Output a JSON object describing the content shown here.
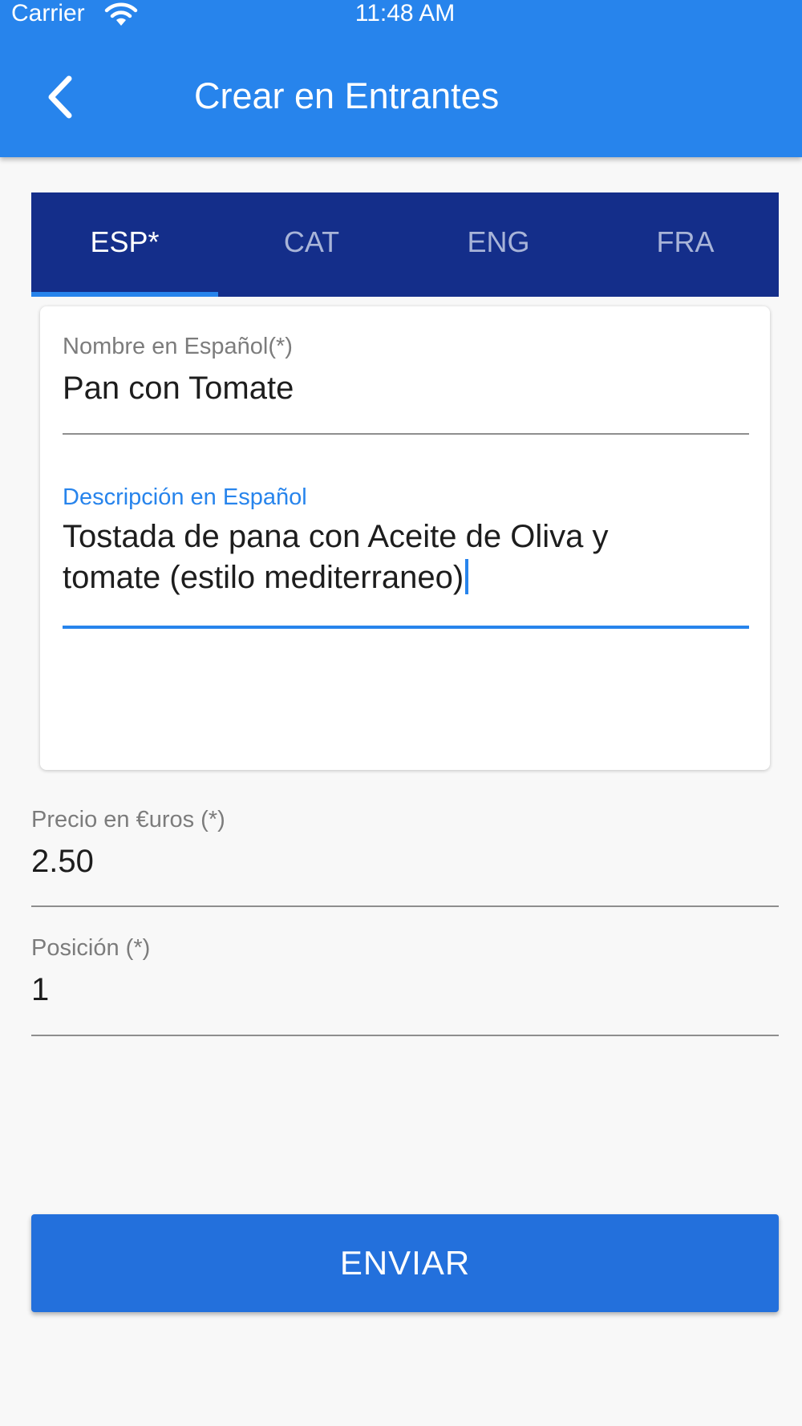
{
  "status_bar": {
    "carrier": "Carrier",
    "time": "11:48 AM"
  },
  "header": {
    "title": "Crear en Entrantes",
    "back_icon": "chevron-left-icon",
    "background_color": "#2784ec"
  },
  "tabs": {
    "items": [
      {
        "label": "ESP*",
        "active": true
      },
      {
        "label": "CAT",
        "active": false
      },
      {
        "label": "ENG",
        "active": false
      },
      {
        "label": "FRA",
        "active": false
      }
    ],
    "background_color": "#142e8a",
    "indicator_color": "#2784ec"
  },
  "form": {
    "name": {
      "label": "Nombre en Español(*)",
      "value": "Pan con Tomate"
    },
    "description": {
      "label": "Descripción en Español",
      "value": "Tostada de pana con Aceite de Oliva y\ntomate (estilo mediterraneo)",
      "focused": true
    },
    "price": {
      "label": "Precio en €uros (*)",
      "value": "2.50"
    },
    "position": {
      "label": "Posición (*)",
      "value": "1"
    }
  },
  "submit": {
    "label": "ENVIAR",
    "color": "#2370dc"
  }
}
